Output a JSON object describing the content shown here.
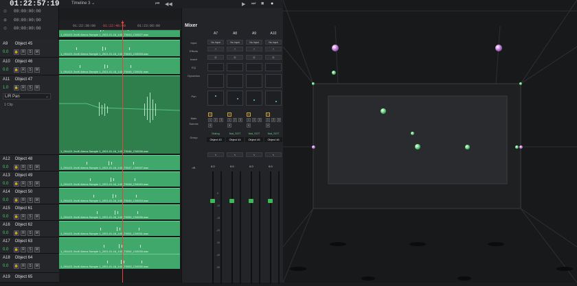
{
  "header": {
    "timecode": "01:22:57:19",
    "timeline_name": "Timeline 3",
    "timecode_rows": [
      "00:00:00:00",
      "00:00:00:00",
      "00:00:00:00"
    ]
  },
  "ruler": {
    "ticks": [
      "01:22:30:00",
      "01:22:48:00",
      "01:23:06:00"
    ]
  },
  "tracks": [
    {
      "id": "A9",
      "name": "Object 45",
      "level": "0.0"
    },
    {
      "id": "A10",
      "name": "Object 46",
      "level": "0.0"
    },
    {
      "id": "A11",
      "name": "Object 47",
      "level": "1.0",
      "pan": "L/R Pan",
      "clips": "1 Clip"
    },
    {
      "id": "A12",
      "name": "Object 48",
      "level": "0.0"
    },
    {
      "id": "A13",
      "name": "Object 49",
      "level": "0.0"
    },
    {
      "id": "A14",
      "name": "Object 50",
      "level": "0.0"
    },
    {
      "id": "A15",
      "name": "Object 61",
      "level": "0.0"
    },
    {
      "id": "A16",
      "name": "Object 62",
      "level": "0.0"
    },
    {
      "id": "A17",
      "name": "Object 63",
      "level": "0.0"
    },
    {
      "id": "A18",
      "name": "Object 64",
      "level": "0.0"
    },
    {
      "id": "A19",
      "name": "Object 65",
      "level": ""
    }
  ],
  "track_buttons": [
    "R",
    "S",
    "M"
  ],
  "clips": [
    "1_091421 2ndK Atmos Sample 1_2021-01-16_143_T0043_C00027.wav",
    "1_091421 2ndK Atmos Sample 1_2021-01-16_143_T0043_C00028.wav",
    "1_091421 2ndK Atmos Sample 1_2021-01-16_143_T0045_C00031.wav",
    "1_091421 2ndK Atmos Sample 1_2021-01-16_143_T0046_C00036.wav",
    "1_091421 2ndK Atmos Sample 1_2021-01-16_143_T0047_C00037.wav",
    "1_091421 2ndK Atmos Sample 1_2021-01-16_143_T0048_C00040.wav",
    "1_091421 2ndK Atmos Sample 1_2021-01-16_143_T0049_C00033.wav",
    "1_091421 2ndK Atmos Sample 1_2021-01-16_143_T0050_C00036.wav",
    "1_091421 2ndK Atmos Sample 1_2021-01-16_143_T0051_C00031.wav",
    "1_091421 2ndK Atmos Sample 1_2021-01-16_143_T0052_C00035.wav",
    "1_091421 2ndK Atmos Sample 1_2021-01-16_143_T0053_C00030.wav"
  ],
  "mixer": {
    "title": "Mixer",
    "row_labels": [
      "Input",
      "Effects",
      "Insert",
      "EQ",
      "Dynamics",
      "Pan",
      "Main",
      "Submix",
      "Group",
      "dB"
    ],
    "strips": [
      {
        "channel": "A7",
        "input": "No Input",
        "group": "Dialog",
        "name": "Object 43",
        "db": "0.0"
      },
      {
        "channel": "A8",
        "input": "No Input",
        "group": "Nat_SOT",
        "name": "Object 44",
        "db": "0.0"
      },
      {
        "channel": "A9",
        "input": "No Input",
        "group": "Nat_SOT",
        "name": "Object 45",
        "db": "0.0"
      },
      {
        "channel": "A10",
        "input": "No Input",
        "group": "Nat_SOT",
        "name": "Object 46",
        "db": "0.0"
      }
    ],
    "db_scale": [
      "-5",
      "-10",
      "-15",
      "-20",
      "-30",
      "-40",
      "-50"
    ]
  },
  "colors": {
    "clip": "#3fa86a",
    "playhead": "#e5463a",
    "object": "#5fd37a",
    "object_alt": "#c07ad8"
  }
}
